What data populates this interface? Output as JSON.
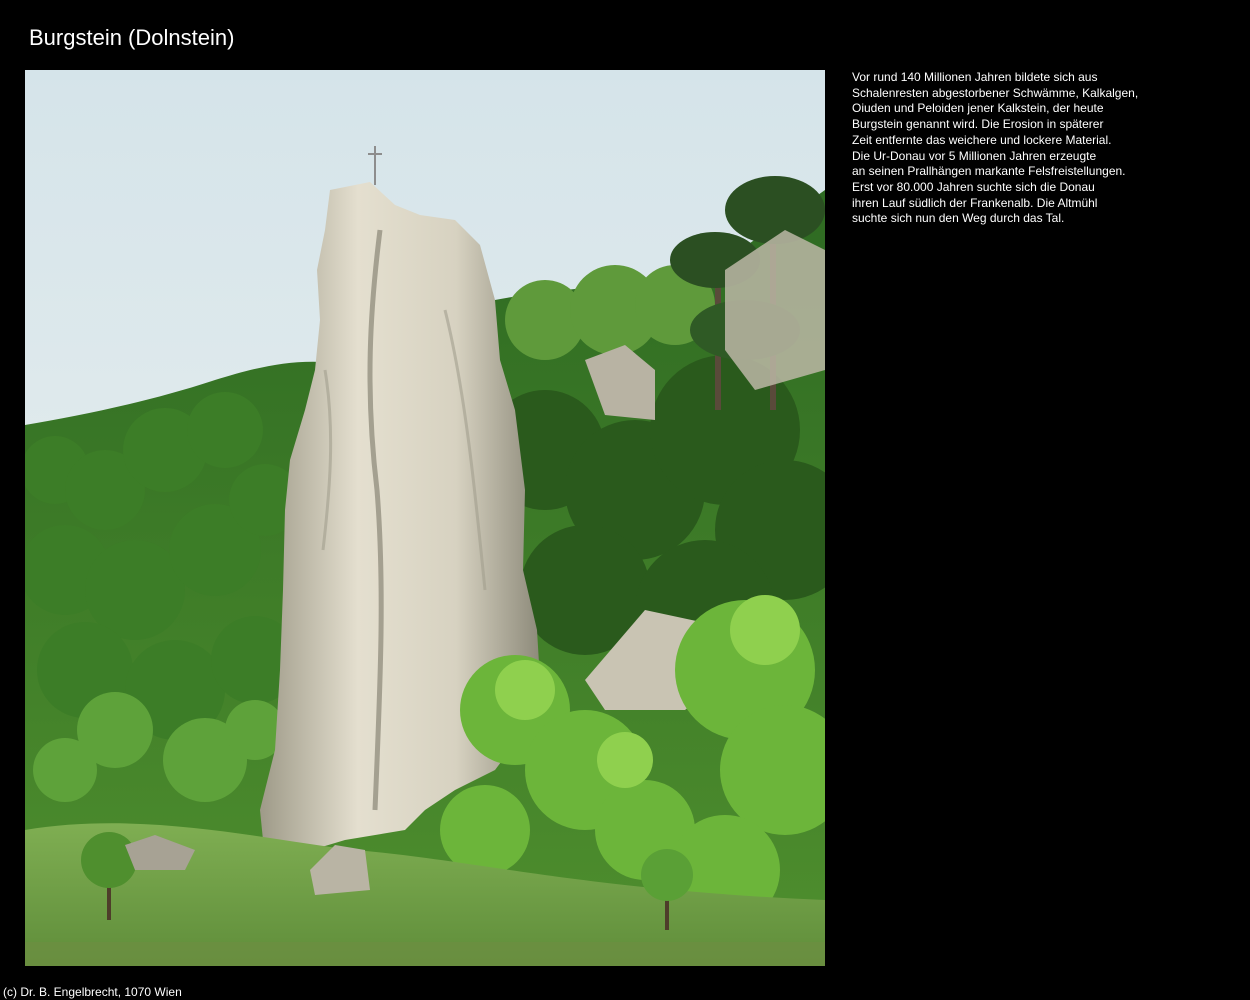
{
  "page": {
    "title": "Burgstein (Dolnstein)",
    "copyright": "(c) Dr. B. Engelbrecht, 1070 Wien"
  },
  "description": {
    "lines": [
      "Vor rund 140 Millionen Jahren bildete sich aus",
      "Schalenresten abgestorbener Schwämme, Kalkalgen,",
      "Oiuden und Peloiden jener Kalkstein, der heute",
      "Burgstein genannt wird. Die Erosion in späterer",
      "Zeit entfernte das weichere und lockere Material.",
      "Die Ur-Donau vor 5 Millionen Jahren erzeugte",
      "an seinen Prallhängen markante Felsfreistellungen.",
      "Erst vor 80.000 Jahren suchte sich die Donau",
      "ihren Lauf südlich der Frankenalb. Die Altmühl",
      "suchte sich nun den Weg durch das Tal."
    ]
  },
  "colors": {
    "background": "#000000",
    "text": "#ffffff",
    "sky": "#dfeaee",
    "forest_dark": "#2f6a1f",
    "forest_light": "#6fb33a",
    "rock": "#cfcab8",
    "meadow": "#8fb860"
  }
}
